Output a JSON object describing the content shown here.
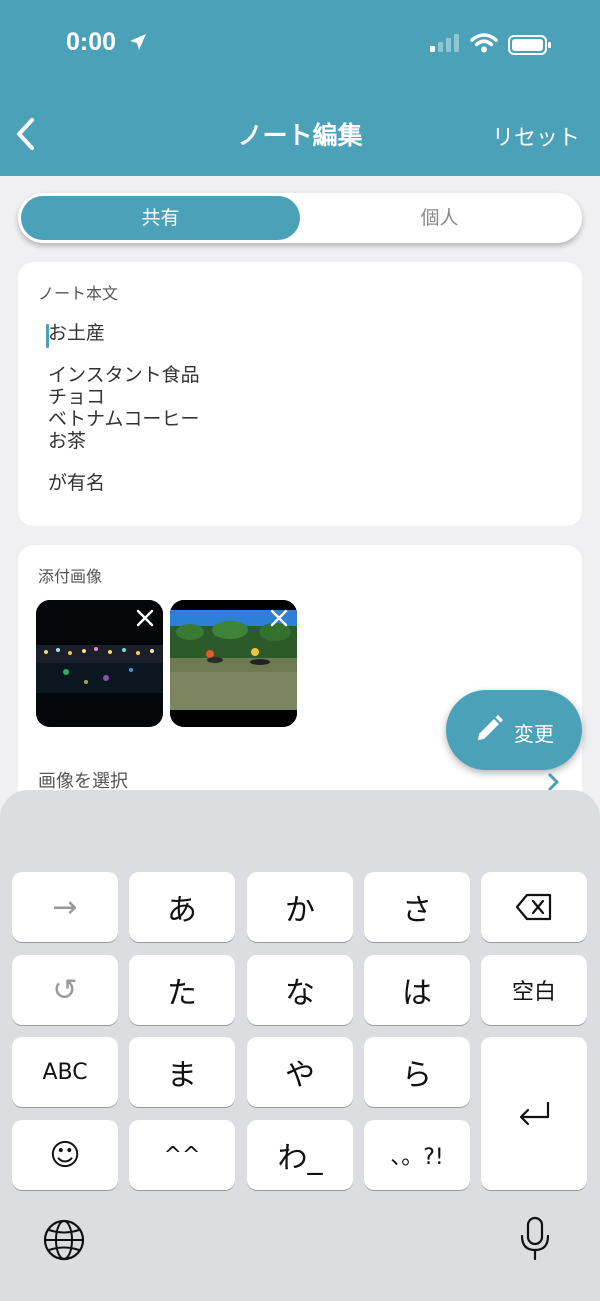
{
  "status_bar": {
    "time": "0:00"
  },
  "nav": {
    "title": "ノート編集",
    "reset": "リセット"
  },
  "segment": {
    "shared": "共有",
    "personal": "個人"
  },
  "note": {
    "label": "ノート本文",
    "lines": [
      "お土産",
      "",
      "インスタント食品",
      "チョコ",
      "ベトナムコーヒー",
      "お茶",
      "",
      "が有名"
    ]
  },
  "attachments": {
    "label": "添付画像",
    "select_label": "画像を選択"
  },
  "fab": {
    "label": "変更"
  },
  "keyboard": {
    "row1": [
      "→",
      "あ",
      "か",
      "さ",
      "⌫"
    ],
    "row2": [
      "↺",
      "た",
      "な",
      "は",
      "空白"
    ],
    "row3": [
      "ABC",
      "ま",
      "や",
      "ら"
    ],
    "row4": [
      "☺",
      "^^",
      "わ_",
      "、。?!"
    ],
    "enter": "⏎"
  },
  "colors": {
    "accent": "#4ba1b8"
  }
}
